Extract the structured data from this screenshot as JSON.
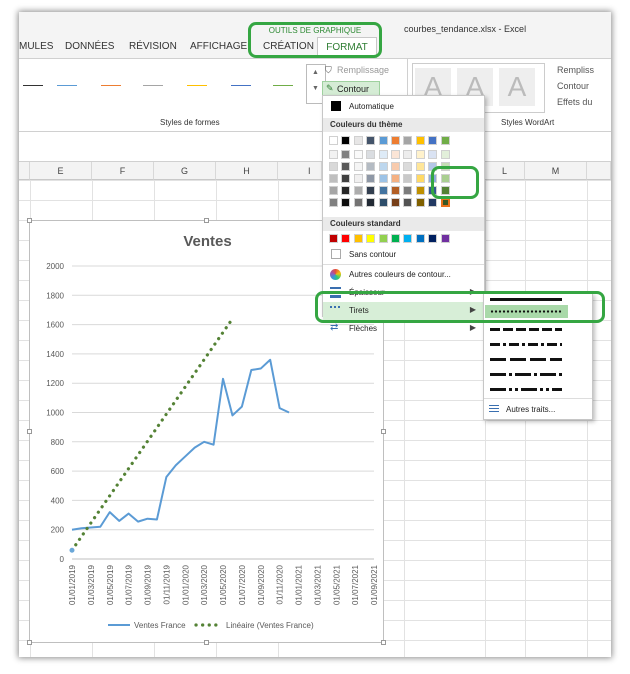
{
  "window": {
    "title": "courbes_tendance.xlsx - Excel"
  },
  "ribbon": {
    "tabs": [
      "MULES",
      "DONNÉES",
      "RÉVISION",
      "AFFICHAGE",
      "CRÉATION"
    ],
    "context_group": "OUTILS DE GRAPHIQUE",
    "active_tab": "FORMAT",
    "shape_fill": "Remplissage",
    "shape_outline": "Contour",
    "group_shapes": "Styles de formes",
    "group_wordart": "Styles WordArt",
    "wordart_fill": "Rempliss",
    "wordart_outline": "Contour",
    "wordart_effects": "Effets du",
    "wordart_letter": "A"
  },
  "columns": [
    "E",
    "F",
    "G",
    "H",
    "I",
    "L",
    "M"
  ],
  "menu": {
    "automatic": "Automatique",
    "theme_colors": "Couleurs du thème",
    "standard_colors": "Couleurs standard",
    "no_outline": "Sans contour",
    "more_colors": "Autres couleurs de contour...",
    "weight": "Épaisseur",
    "dashes": "Tirets",
    "arrows": "Flèches",
    "theme_top": [
      "#ffffff",
      "#000000",
      "#e7e6e6",
      "#44546a",
      "#5b9bd5",
      "#ed7d31",
      "#a5a5a5",
      "#ffc000",
      "#4472c4",
      "#70ad47"
    ],
    "standard": [
      "#c00000",
      "#ff0000",
      "#ffc000",
      "#ffff00",
      "#92d050",
      "#00b050",
      "#00b0f0",
      "#0070c0",
      "#002060",
      "#7030a0"
    ]
  },
  "submenu": {
    "more_dashes": "Autres traits..."
  },
  "chart_data": {
    "type": "line",
    "title": "Ventes",
    "x": [
      "01/01/2019",
      "01/02/2019",
      "01/03/2019",
      "01/04/2019",
      "01/05/2019",
      "01/06/2019",
      "01/07/2019",
      "01/08/2019",
      "01/09/2019",
      "01/10/2019",
      "01/11/2019",
      "01/12/2019",
      "01/01/2020",
      "01/02/2020",
      "01/03/2020",
      "01/04/2020",
      "01/05/2020",
      "01/06/2020",
      "01/07/2020",
      "01/08/2020",
      "01/09/2020",
      "01/10/2020",
      "01/11/2020",
      "01/12/2020"
    ],
    "x_tick_labels": [
      "01/01/2019",
      "01/03/2019",
      "01/05/2019",
      "01/07/2019",
      "01/09/2019",
      "01/11/2019",
      "01/01/2020",
      "01/03/2020",
      "01/05/2020",
      "01/07/2020",
      "01/09/2020",
      "01/11/2020",
      "01/01/2021",
      "01/03/2021",
      "01/05/2021",
      "01/07/2021",
      "01/09/2021"
    ],
    "ylim": [
      0,
      2000
    ],
    "y_ticks": [
      0,
      200,
      400,
      600,
      800,
      1000,
      1200,
      1400,
      1600,
      1800,
      2000
    ],
    "series": [
      {
        "name": "Ventes France",
        "color": "#5b9bd5",
        "style": "solid",
        "values": [
          200,
          210,
          215,
          220,
          320,
          260,
          310,
          255,
          275,
          270,
          560,
          640,
          700,
          760,
          800,
          780,
          1230,
          980,
          1040,
          1290,
          1300,
          1360,
          1030,
          1000
        ]
      },
      {
        "name": "Linéaire (Ventes France)",
        "color": "#548235",
        "style": "dotted",
        "from": "01/01/2019",
        "to": "01/06/2020",
        "y_start": 60,
        "y_end": 1640
      }
    ],
    "legend_position": "bottom"
  }
}
